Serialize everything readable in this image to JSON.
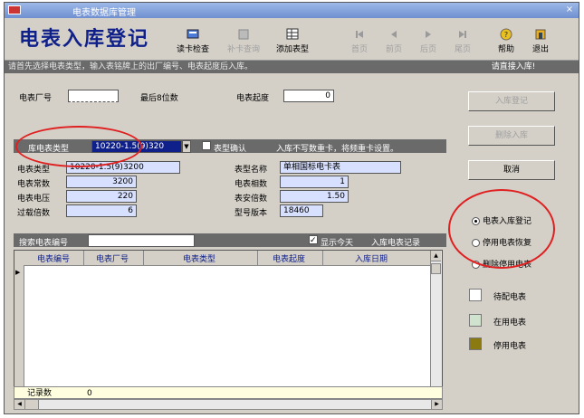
{
  "window": {
    "title": "电表数据库管理"
  },
  "header": {
    "app_title": "电表入库登记"
  },
  "toolbar": {
    "read_card": "读卡检查",
    "disabled1": "补卡查询",
    "add_type": "添加表型",
    "nav1": "首页",
    "nav2": "前页",
    "nav3": "后页",
    "nav4": "尾页",
    "help": "帮助",
    "exit": "退出"
  },
  "hint": "请首先选择电表类型，输入表铭牌上的出厂编号、电表起度后入库。",
  "right_hint": "请直接入库!",
  "form": {
    "factory_no_label": "电表厂号",
    "factory_no_value": "",
    "last8_label": "最后8位数",
    "start_reading_label": "电表起度",
    "start_reading_value": "0",
    "meter_type_select_label": "库电表类型",
    "meter_type_select_value": "10220-1.5(9)320",
    "confirm_label": "表型确认",
    "confirm_hint": "入库不写数重卡，将频重卡设置。",
    "meter_type_label": "电表类型",
    "meter_type_value": "10220-1.5(9)3200",
    "meter_const_label": "电表常数",
    "meter_const_value": "3200",
    "meter_voltage_label": "电表电压",
    "meter_voltage_value": "220",
    "overcurrent_label": "过载倍数",
    "overcurrent_value": "6",
    "model_name_label": "表型名称",
    "model_name_value": "单相国标电卡表",
    "phase_label": "电表相数",
    "phase_value": "1",
    "ratio_label": "表安倍数",
    "ratio_value": "1.50",
    "model_code_label": "型号版本",
    "model_code_value": "18460"
  },
  "search": {
    "label": "搜索电表编号",
    "value": "",
    "show_today_label": "显示今天",
    "show_today_hint": "入库电表记录"
  },
  "table": {
    "columns": [
      "电表编号",
      "电表厂号",
      "电表类型",
      "电表起度",
      "入库日期"
    ],
    "record_label": "记录数",
    "record_count": "0"
  },
  "side": {
    "btn_save": "入库登记",
    "btn_delete": "删除入库",
    "btn_cancel": "取消",
    "radio1": "电表入库登记",
    "radio2": "停用电表恢复",
    "radio3": "删除停用电表",
    "legend1": "待配电表",
    "legend2": "在用电表",
    "legend3": "停用电表"
  },
  "colors": {
    "legend1": "#ffffff",
    "legend2": "#cfe3cf",
    "legend3": "#8a7a10",
    "annotation": "#e02020"
  }
}
